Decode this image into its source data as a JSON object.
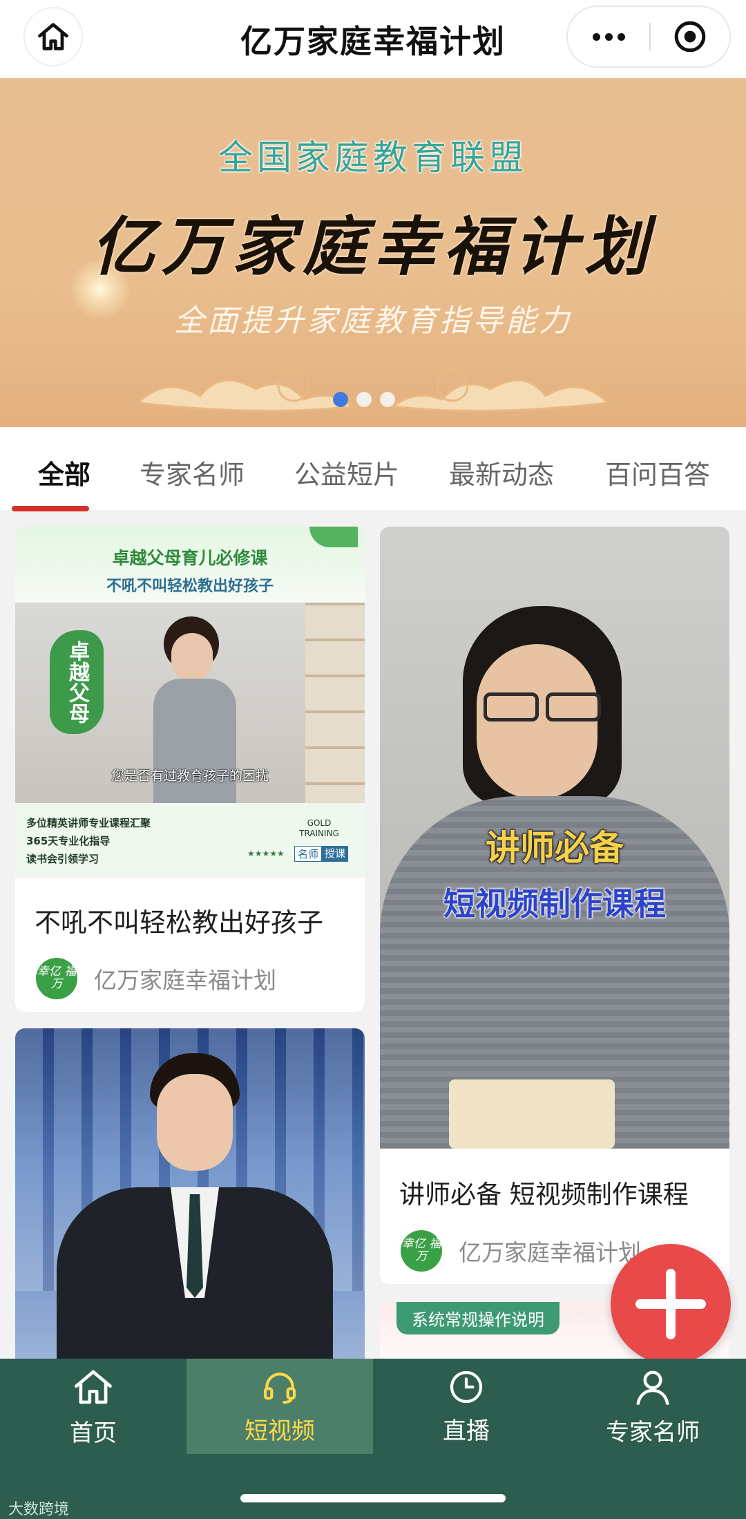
{
  "header": {
    "title": "亿万家庭幸福计划"
  },
  "banner": {
    "subtitle": "全国家庭教育联盟",
    "headline": "亿万家庭幸福计划",
    "tagline": "全面提升家庭教育指导能力",
    "slide_count": 3,
    "active_slide": 1
  },
  "tabs": [
    {
      "label": "全部",
      "active": true
    },
    {
      "label": "专家名师",
      "active": false
    },
    {
      "label": "公益短片",
      "active": false
    },
    {
      "label": "最新动态",
      "active": false
    },
    {
      "label": "百问百答",
      "active": false
    }
  ],
  "cards": {
    "card1": {
      "poster_header_1": "卓越父母育儿必修课",
      "poster_header_2": "不吼不叫轻松教出好孩子",
      "poster_badge": "卓越父母",
      "poster_subtitle": "您是否有过教育孩子的困扰",
      "poster_bullets": [
        "多位精英讲师专业课程汇聚",
        "365天专业化指导",
        "读书会引领学习"
      ],
      "poster_gold": "GOLD TRAINING",
      "poster_stars": "★★★★★",
      "poster_tag_a": "名师",
      "poster_tag_b": "授课",
      "title": "不吼不叫轻松教出好孩子",
      "author": "亿万家庭幸福计划",
      "author_logo": "幸亿 福万"
    },
    "card2": {
      "overlay_1": "讲师必备",
      "overlay_2": "短视频制作课程",
      "title": "讲师必备 短视频制作课程",
      "author": "亿万家庭幸福计划",
      "author_logo": "幸亿 福万"
    },
    "card4": {
      "badge": "系统常规操作说明"
    }
  },
  "bottom_nav": [
    {
      "label": "首页",
      "icon": "home-icon",
      "active": false
    },
    {
      "label": "短视频",
      "icon": "headset-icon",
      "active": true
    },
    {
      "label": "直播",
      "icon": "clock-icon",
      "active": false
    },
    {
      "label": "专家名师",
      "icon": "user-icon",
      "active": false
    }
  ],
  "watermark": "大数跨境",
  "colors": {
    "nav_bg": "#2d5d4f",
    "nav_active_bg": "#4c7f69",
    "nav_active_text": "#ffd84a",
    "tab_underline": "#d6302a",
    "fab": "#e84a4a",
    "banner_bg": "#e8bd90"
  }
}
